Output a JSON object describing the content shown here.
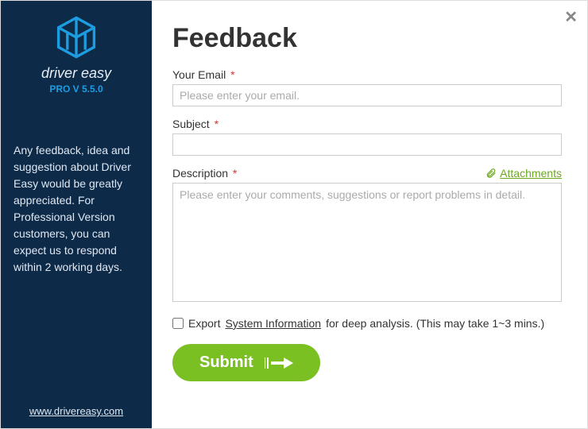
{
  "sidebar": {
    "product_name": "driver easy",
    "version_label": "PRO V 5.5.0",
    "info_text": "Any feedback, idea and suggestion about Driver Easy would be greatly appreciated. For Professional Version customers, you can expect us to respond within 2 working days.",
    "website": "www.drivereasy.com"
  },
  "main": {
    "title": "Feedback",
    "email_label": "Your Email",
    "email_placeholder": "Please enter your email.",
    "subject_label": "Subject",
    "description_label": "Description",
    "description_placeholder": "Please enter your comments, suggestions or report problems in detail.",
    "attachments_label": "Attachments",
    "export_prefix": "Export",
    "system_info_label": "System Information",
    "export_suffix": "for deep analysis. (This may take 1~3 mins.)",
    "submit_label": "Submit"
  },
  "colors": {
    "sidebar_bg": "#0d2a48",
    "accent_blue": "#1d9de0",
    "accent_green": "#7ac023",
    "required": "#d33"
  }
}
